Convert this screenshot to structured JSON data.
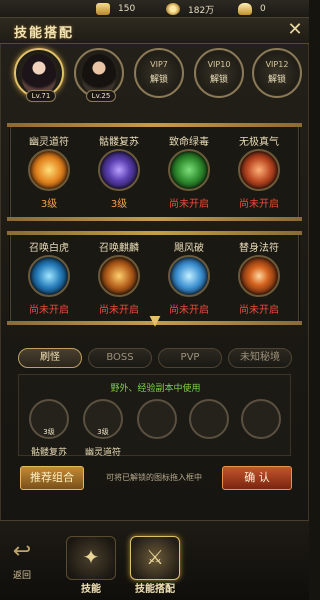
{
  "resources": [
    {
      "icon": "gold-ingot-icon",
      "value": "150"
    },
    {
      "icon": "coin-icon",
      "value": "182万"
    },
    {
      "icon": "yuanbao-icon",
      "value": "0"
    }
  ],
  "title": "技能搭配",
  "heroes": [
    {
      "level": "Lv.71",
      "active": true
    },
    {
      "level": "Lv.25",
      "active": false
    }
  ],
  "vip_slots": [
    {
      "name": "VIP7",
      "lock": "解锁"
    },
    {
      "name": "VIP10",
      "lock": "解锁"
    },
    {
      "name": "VIP12",
      "lock": "解锁"
    }
  ],
  "skills_row1": [
    {
      "name": "幽灵道符",
      "status": "3级",
      "locked": false
    },
    {
      "name": "骷髅复苏",
      "status": "3级",
      "locked": false
    },
    {
      "name": "致命绿毒",
      "status": "尚未开启",
      "locked": true
    },
    {
      "name": "无极真气",
      "status": "尚未开启",
      "locked": true
    }
  ],
  "skills_row2": [
    {
      "name": "召唤白虎",
      "status": "尚未开启",
      "locked": true
    },
    {
      "name": "召唤麒麟",
      "status": "尚未开启",
      "locked": true
    },
    {
      "name": "飓风破",
      "status": "尚未开启",
      "locked": true
    },
    {
      "name": "替身法符",
      "status": "尚未开启",
      "locked": true
    }
  ],
  "tabs": [
    "刷怪",
    "BOSS",
    "PVP",
    "未知秘境"
  ],
  "equip_hint": "野外、经验副本中使用",
  "equipped": [
    {
      "name": "骷髅复苏",
      "level": "3级"
    },
    {
      "name": "幽灵道符",
      "level": "3级"
    }
  ],
  "buttons": {
    "combo": "推荐组合",
    "confirm": "确 认",
    "drag_tip": "可将已解锁的图标拖入框中"
  },
  "nav": {
    "back": "返回",
    "items": [
      "技能",
      "技能搭配"
    ]
  },
  "colors": {
    "accent_gold": "#e3c26c",
    "level_orange": "#f2a742",
    "locked_red": "#e84c38",
    "hint_green": "#7fd04b"
  }
}
